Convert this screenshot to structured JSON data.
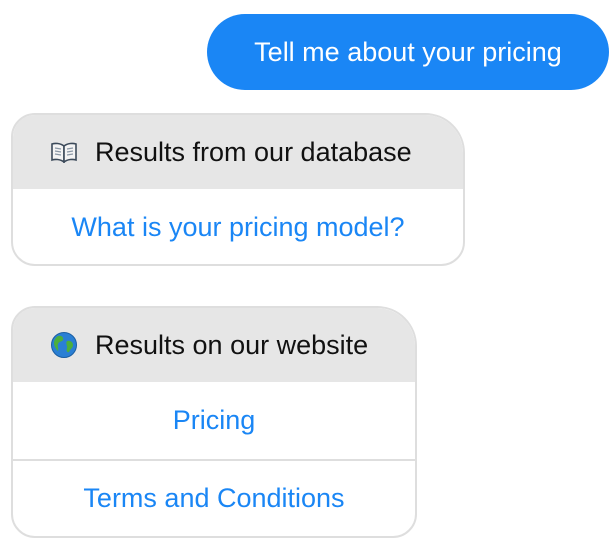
{
  "conversation": {
    "user_message": "Tell me about your pricing",
    "cards": [
      {
        "icon": "open-book-icon",
        "header": "Results from our database",
        "items": [
          "What is your pricing model?"
        ]
      },
      {
        "icon": "globe-icon",
        "header": "Results on our website",
        "items": [
          "Pricing",
          "Terms and Conditions"
        ]
      }
    ]
  },
  "colors": {
    "user_bubble": "#1a86f5",
    "link_text": "#1a86f5",
    "card_header_bg": "#e6e6e6",
    "card_border": "#dedede"
  }
}
